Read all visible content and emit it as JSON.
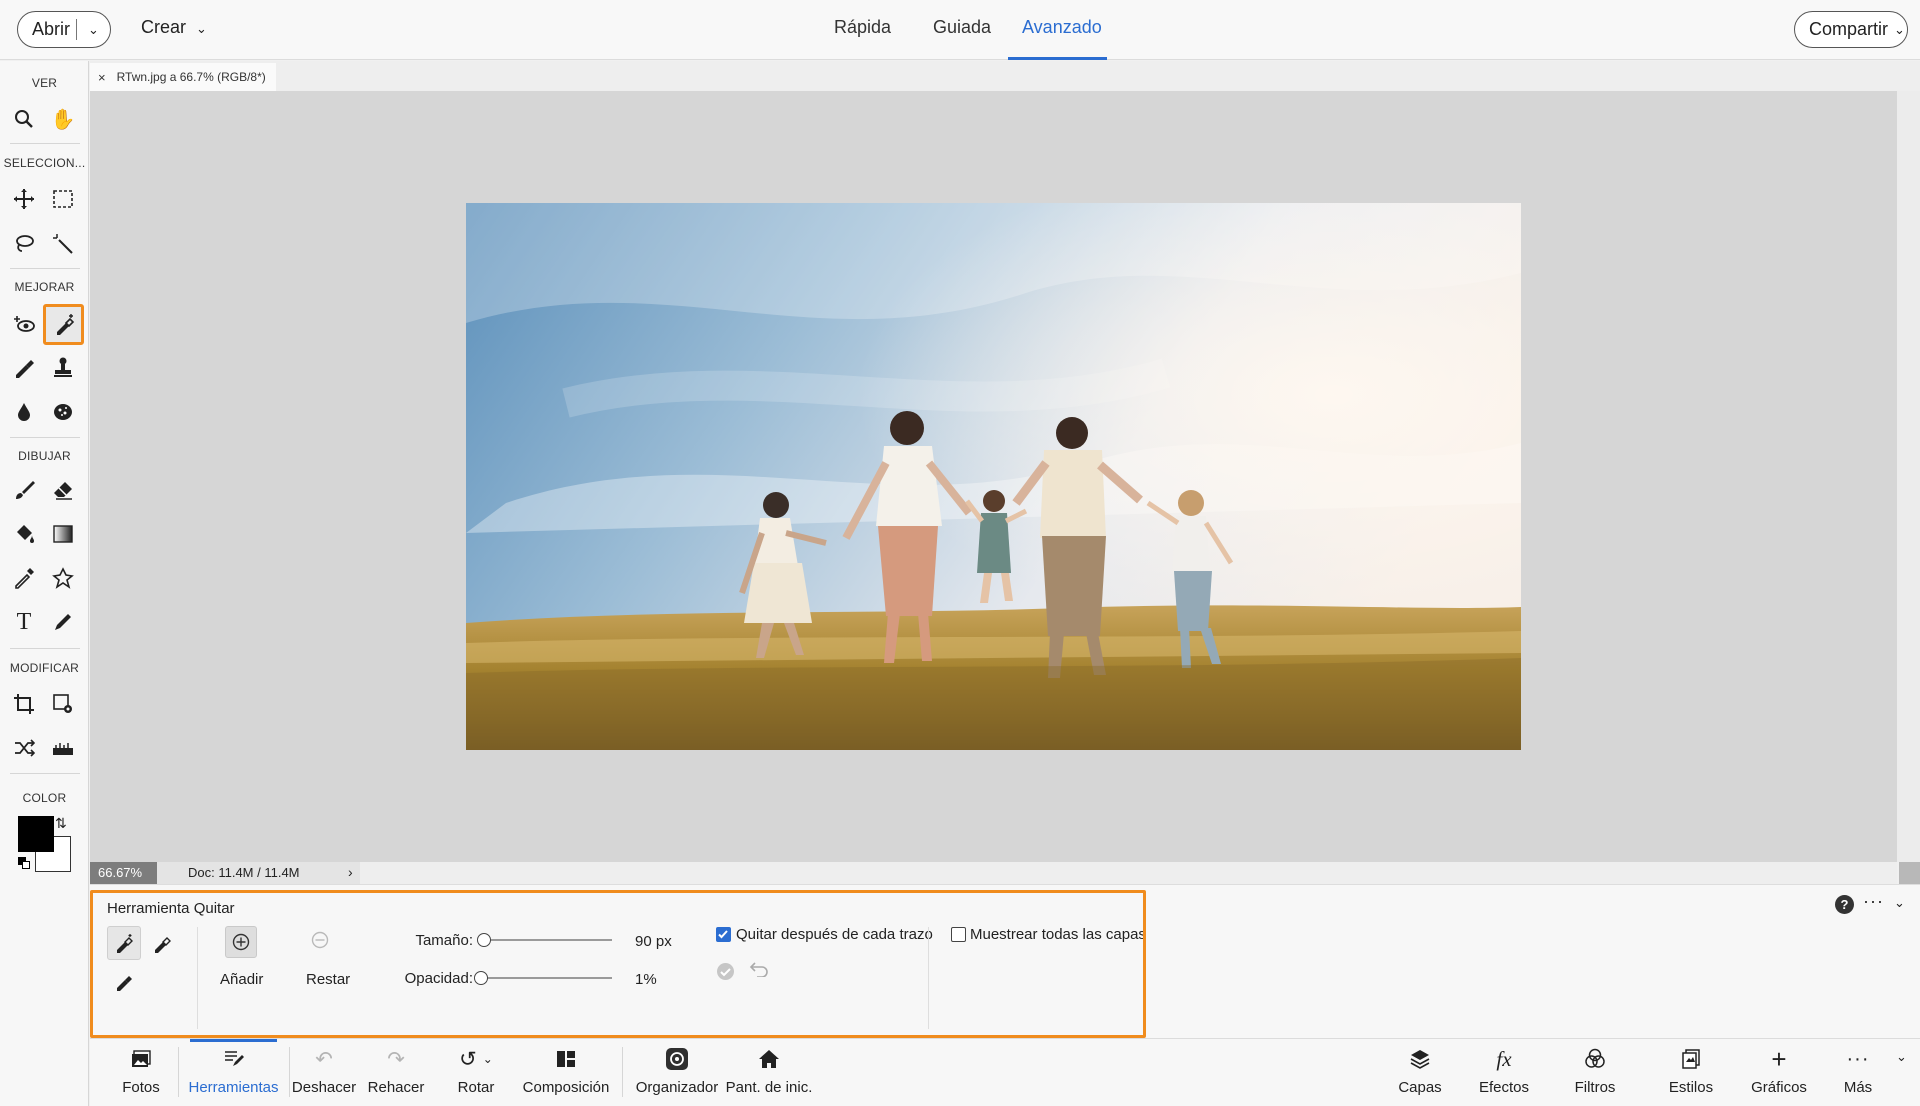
{
  "topbar": {
    "open_label": "Abrir",
    "create_label": "Crear",
    "modes": [
      "Rápida",
      "Guiada",
      "Avanzado"
    ],
    "active_mode": "Avanzado",
    "share_label": "Compartir",
    "accent_color": "#2b6dd1"
  },
  "toolbox": {
    "sections": {
      "view": "VER",
      "select": "SELECCION...",
      "enhance": "MEJORAR",
      "draw": "DIBUJAR",
      "modify": "MODIFICAR",
      "color": "COLOR"
    },
    "active_tool": "remove-tool",
    "highlight_color": "#f08c1e",
    "foreground_color": "#000000",
    "background_color": "#ffffff"
  },
  "document": {
    "tab_title": "RTwn.jpg a 66.7% (RGB/8*)",
    "zoom": "66.67%",
    "doc_size": "Doc: 11.4M / 11.4M"
  },
  "tool_options": {
    "title": "Herramienta Quitar",
    "add_label": "Añadir",
    "subtract_label": "Restar",
    "size_label": "Tamaño:",
    "size_value": "90 px",
    "size_fraction": 0.0,
    "opacity_label": "Opacidad:",
    "opacity_value": "1%",
    "opacity_fraction": 0.01,
    "remove_after_stroke_label": "Quitar después de cada trazo",
    "remove_after_stroke_checked": true,
    "sample_all_layers_label": "Muestrear todas las capas",
    "sample_all_layers_checked": false
  },
  "taskbar": {
    "left": [
      "Fotos",
      "Herramientas",
      "Deshacer",
      "Rehacer",
      "Rotar",
      "Composición",
      "Organizador",
      "Pant. de inic."
    ],
    "active": "Herramientas",
    "right": [
      "Capas",
      "Efectos",
      "Filtros",
      "Estilos",
      "Gráficos",
      "Más"
    ]
  }
}
